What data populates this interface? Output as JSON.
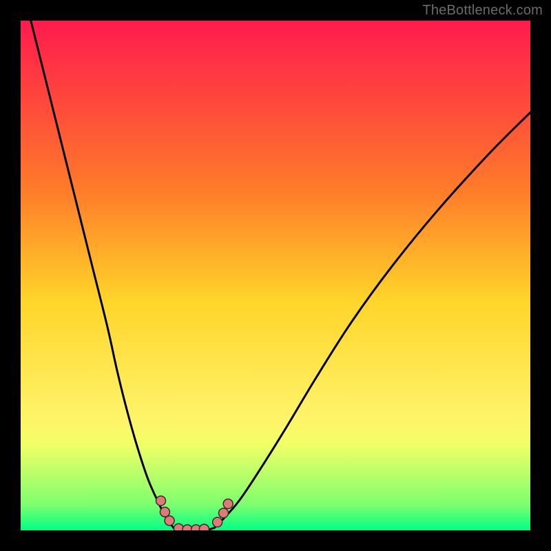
{
  "watermark": {
    "text": "TheBottleneck.com"
  },
  "chart_data": {
    "type": "line",
    "title": "",
    "xlabel": "",
    "ylabel": "",
    "x_range": [
      0,
      100
    ],
    "y_range": [
      0,
      100
    ],
    "grid": false,
    "legend": false,
    "background_gradient": {
      "stops": [
        {
          "offset": 0,
          "color": "#ff1a4d"
        },
        {
          "offset": 0.33,
          "color": "#ff7a2a"
        },
        {
          "offset": 0.55,
          "color": "#ffd52a"
        },
        {
          "offset": 0.78,
          "color": "#fff36a"
        },
        {
          "offset": 0.83,
          "color": "#f3ff66"
        },
        {
          "offset": 0.95,
          "color": "#7dff6e"
        },
        {
          "offset": 1.0,
          "color": "#00ff85"
        }
      ]
    },
    "series": [
      {
        "name": "left-branch",
        "x": [
          0,
          2,
          5,
          8,
          11,
          14,
          17,
          19,
          21,
          23,
          25,
          27,
          28.5,
          30
        ],
        "y": [
          108,
          100,
          88,
          76,
          64,
          52,
          40,
          31,
          23,
          16,
          10,
          5.5,
          2.5,
          0.5
        ]
      },
      {
        "name": "right-branch",
        "x": [
          38,
          40,
          43,
          47,
          52,
          58,
          65,
          73,
          82,
          92,
          100
        ],
        "y": [
          0.5,
          2.5,
          6,
          12,
          20,
          30,
          41,
          52,
          63,
          74,
          82
        ]
      },
      {
        "name": "bottom-connector",
        "x": [
          30,
          31.5,
          33,
          34.5,
          36,
          37,
          38
        ],
        "y": [
          0.5,
          0.2,
          0.1,
          0.1,
          0.1,
          0.2,
          0.5
        ]
      }
    ],
    "markers": {
      "name": "bead-cluster",
      "color": "#e07a78",
      "radius_px": 7,
      "points": [
        {
          "x": 27.5,
          "y": 5.8
        },
        {
          "x": 28.3,
          "y": 3.6
        },
        {
          "x": 29.2,
          "y": 1.9
        },
        {
          "x": 31.0,
          "y": 0.35
        },
        {
          "x": 32.7,
          "y": 0.15
        },
        {
          "x": 34.4,
          "y": 0.15
        },
        {
          "x": 36.0,
          "y": 0.25
        },
        {
          "x": 38.6,
          "y": 1.6
        },
        {
          "x": 39.8,
          "y": 3.4
        },
        {
          "x": 40.7,
          "y": 5.2
        }
      ]
    }
  }
}
